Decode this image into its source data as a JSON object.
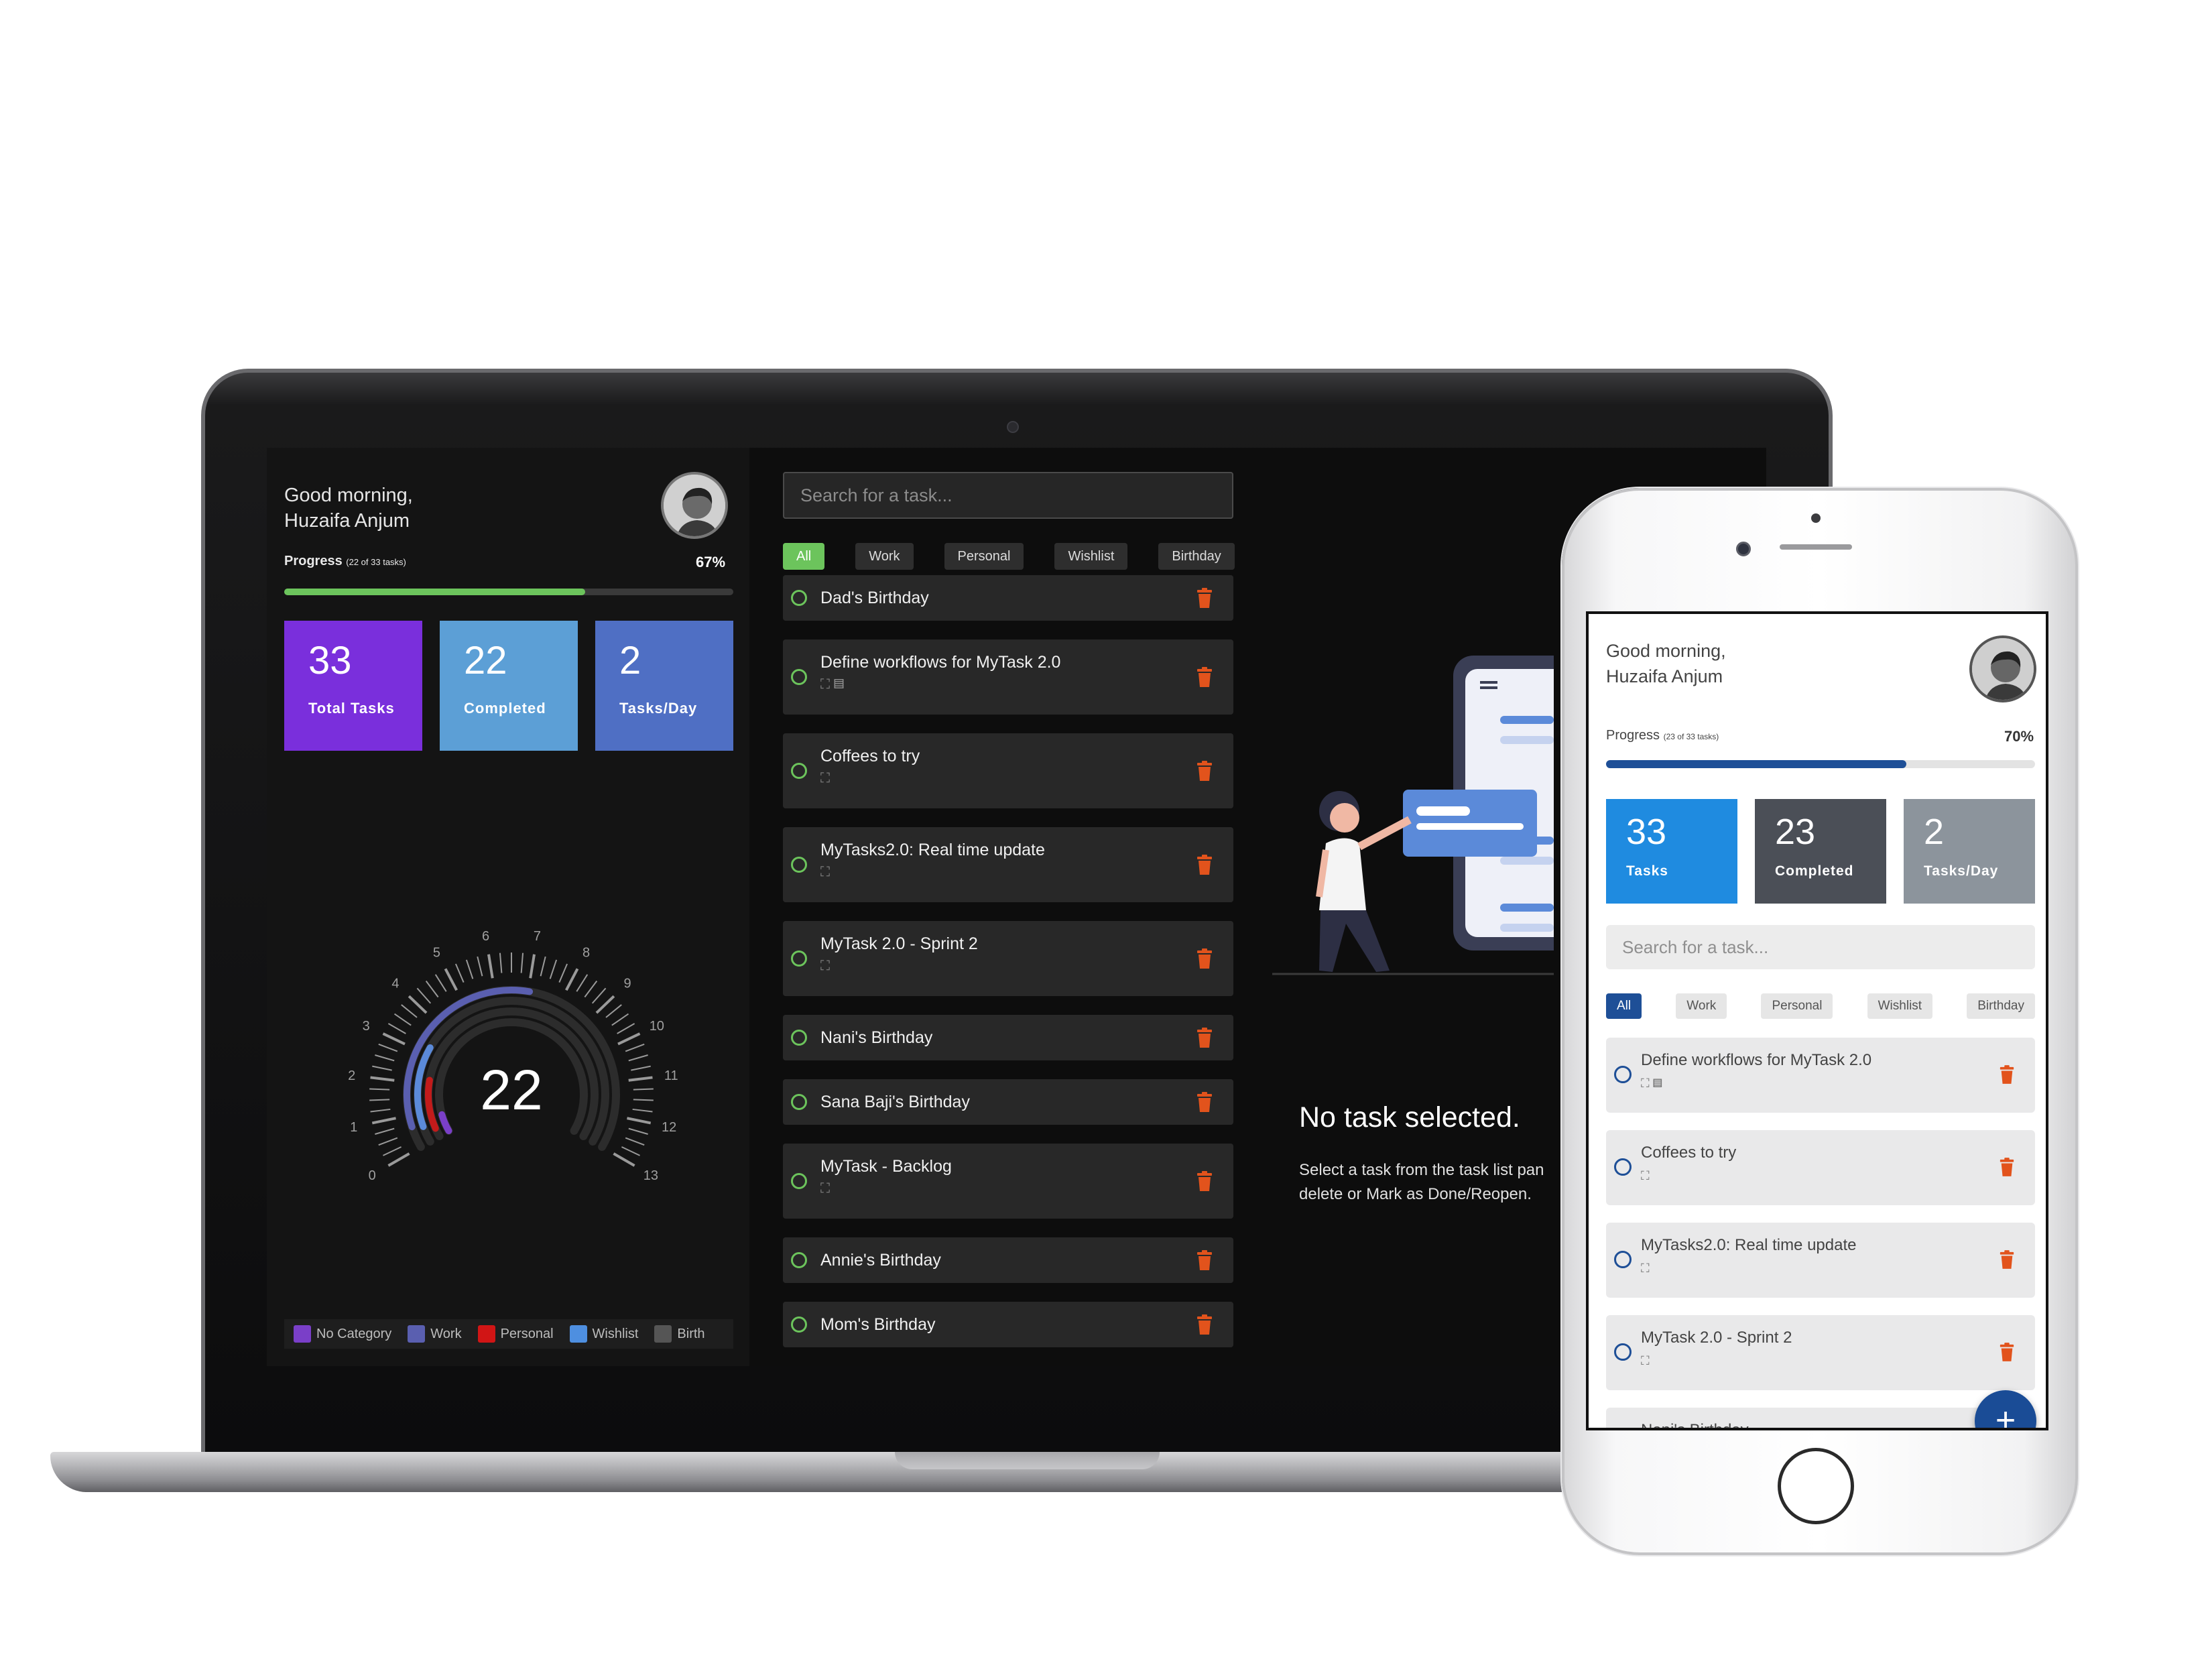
{
  "desktop": {
    "greeting_line1": "Good morning,",
    "greeting_line2": "Huzaifa Anjum",
    "progress_label": "Progress",
    "progress_detail": "(22 of 33 tasks)",
    "progress_pct": "67%",
    "progress_fraction": 0.67,
    "stats": [
      {
        "value": "33",
        "label": "Total Tasks",
        "color": "#7a2fdc"
      },
      {
        "value": "22",
        "label": "Completed",
        "color": "#5c9fd6"
      },
      {
        "value": "2",
        "label": "Tasks/Day",
        "color": "#4f6fc4"
      }
    ],
    "gauge": {
      "value": "22",
      "ticks": [
        "0",
        "1",
        "2",
        "3",
        "4",
        "5",
        "6",
        "7",
        "8",
        "9",
        "10",
        "11",
        "12",
        "13"
      ],
      "accent_colors": [
        "#7a3fc8",
        "#c21b1b",
        "#5b8ad9",
        "#5a5fb0"
      ]
    },
    "legend": [
      {
        "label": "No Category",
        "color": "#7a3fc8"
      },
      {
        "label": "Work",
        "color": "#5a5fb0"
      },
      {
        "label": "Personal",
        "color": "#d11515"
      },
      {
        "label": "Wishlist",
        "color": "#4e8fe0"
      },
      {
        "label": "Birth",
        "color": "#555555"
      }
    ],
    "search_placeholder": "Search for a task...",
    "chips": [
      "All",
      "Work",
      "Personal",
      "Wishlist",
      "Birthday"
    ],
    "tasks": [
      {
        "title": "Dad's Birthday",
        "meta": ""
      },
      {
        "title": "Define workflows for MyTask 2.0",
        "meta": "⛶ ▤"
      },
      {
        "title": "Coffees to try",
        "meta": "⛶"
      },
      {
        "title": "MyTasks2.0: Real time update",
        "meta": "⛶"
      },
      {
        "title": "MyTask 2.0 - Sprint 2",
        "meta": "⛶"
      },
      {
        "title": "Nani's Birthday",
        "meta": ""
      },
      {
        "title": "Sana Baji's Birthday",
        "meta": ""
      },
      {
        "title": "MyTask - Backlog",
        "meta": "⛶"
      },
      {
        "title": "Annie's Birthday",
        "meta": ""
      },
      {
        "title": "Mom's Birthday",
        "meta": ""
      }
    ],
    "no_task_title": "No task selected.",
    "no_task_desc": "Select a task from the task list pan delete or Mark as Done/Reopen.",
    "accent": "#6cc45c",
    "trash_color": "#e2531c"
  },
  "mobile": {
    "greeting_line1": "Good morning,",
    "greeting_line2": "Huzaifa Anjum",
    "progress_label": "Progress",
    "progress_detail": "(23 of 33 tasks)",
    "progress_pct": "70%",
    "progress_fraction": 0.7,
    "stats": [
      {
        "value": "33",
        "label": "Tasks",
        "color": "#1f8be0"
      },
      {
        "value": "23",
        "label": "Completed",
        "color": "#4b4f57"
      },
      {
        "value": "2",
        "label": "Tasks/Day",
        "color": "#8c949c"
      }
    ],
    "search_placeholder": "Search for a task...",
    "chips": [
      "All",
      "Work",
      "Personal",
      "Wishlist",
      "Birthday"
    ],
    "tasks": [
      {
        "title": "Define workflows for MyTask 2.0",
        "meta": "⛶ ▤"
      },
      {
        "title": "Coffees to try",
        "meta": "⛶"
      },
      {
        "title": "MyTasks2.0: Real time update",
        "meta": "⛶"
      },
      {
        "title": "MyTask 2.0 - Sprint 2",
        "meta": "⛶"
      },
      {
        "title": "Nani's Birthday",
        "meta": ""
      }
    ],
    "fab_label": "+",
    "accent": "#1e4f97",
    "trash_color": "#e2531c"
  }
}
